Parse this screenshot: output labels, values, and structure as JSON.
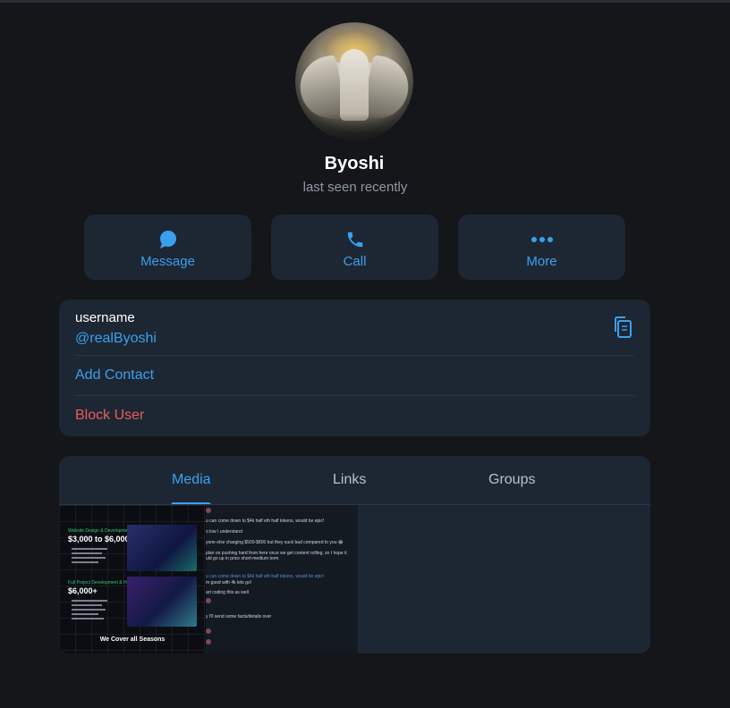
{
  "profile": {
    "name": "Byoshi",
    "status": "last seen recently"
  },
  "actions": [
    {
      "label": "Message",
      "icon": "chat-bubble-icon"
    },
    {
      "label": "Call",
      "icon": "phone-icon"
    },
    {
      "label": "More",
      "icon": "more-dots-icon"
    }
  ],
  "info": {
    "username_title": "username",
    "username_value": "@realByoshi",
    "add_contact": "Add Contact",
    "block_user": "Block User"
  },
  "tabs": {
    "media": "Media",
    "links": "Links",
    "groups": "Groups",
    "active": "Media"
  },
  "thumb1": {
    "heading1": "Website Design & Development",
    "price1": "$3,000 to $6,000",
    "heading2": "Full Project Development & Hosting",
    "price2": "$6,000+",
    "footer": "We Cover all Seasons"
  },
  "thumb2": {
    "lines": [
      "u can come down to $4k half eth half tokens, would be epic!",
      "o low I understand",
      "yone else charging $500-$800 but they suck bad compared to you 😂",
      "plan on pushing hard from here once we get content rolling, so I hope it",
      "uld go up in price short-medium term",
      "u can come down to $4k half eth half tokens, would be epic!",
      "m good with 4k lets go!",
      "art coding this as well",
      "y I'll send some facts/details over"
    ]
  },
  "colors": {
    "background": "#141619",
    "card": "#1d2733",
    "accent": "#3aa0ee",
    "danger": "#e85c5c",
    "muted": "#8f98a3"
  }
}
